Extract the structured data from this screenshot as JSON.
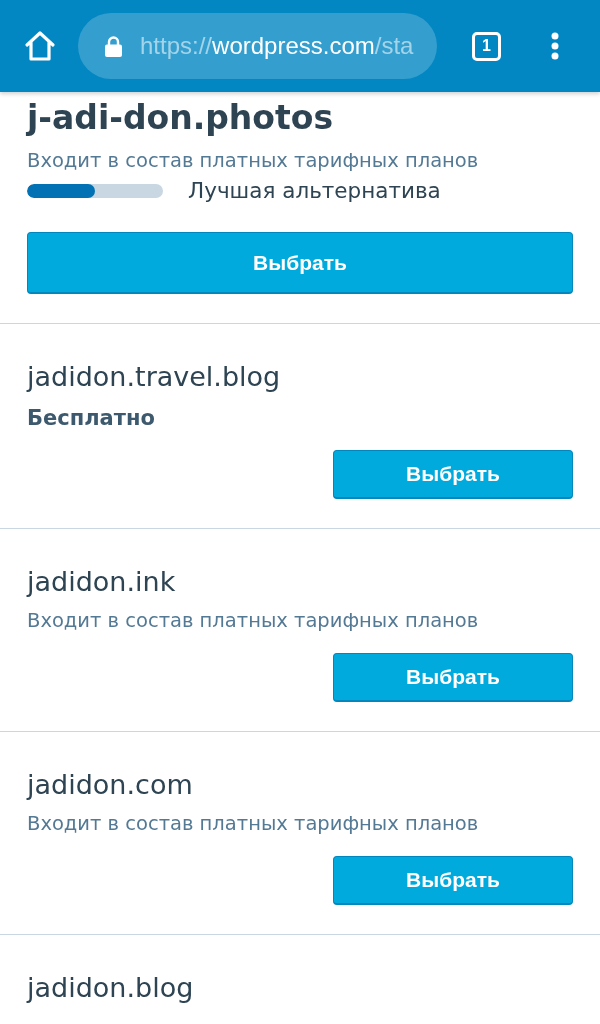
{
  "browser_bar": {
    "url": {
      "scheme": "https://",
      "host": "wordpress.com",
      "path": "/sta"
    },
    "tab_count": "1"
  },
  "cards": [
    {
      "domain": "j-adi-don.photos",
      "featured": true,
      "note": {
        "text": "Входит в состав платных тарифных планов",
        "kind": "included"
      },
      "match": {
        "level": 0.5,
        "label": "Лучшая альтернатива"
      },
      "button": "Выбрать"
    },
    {
      "domain": "jadidon.travel.blog",
      "featured": false,
      "note": {
        "text": "Бесплатно",
        "kind": "free"
      },
      "button": "Выбрать"
    },
    {
      "domain": "jadidon.ink",
      "featured": false,
      "note": {
        "text": "Входит в состав платных тарифных планов",
        "kind": "included"
      },
      "button": "Выбрать"
    },
    {
      "domain": "jadidon.com",
      "featured": false,
      "note": {
        "text": "Входит в состав платных тарифных планов",
        "kind": "included"
      },
      "button": "Выбрать"
    },
    {
      "domain": "jadidon.blog",
      "featured": false
    }
  ]
}
